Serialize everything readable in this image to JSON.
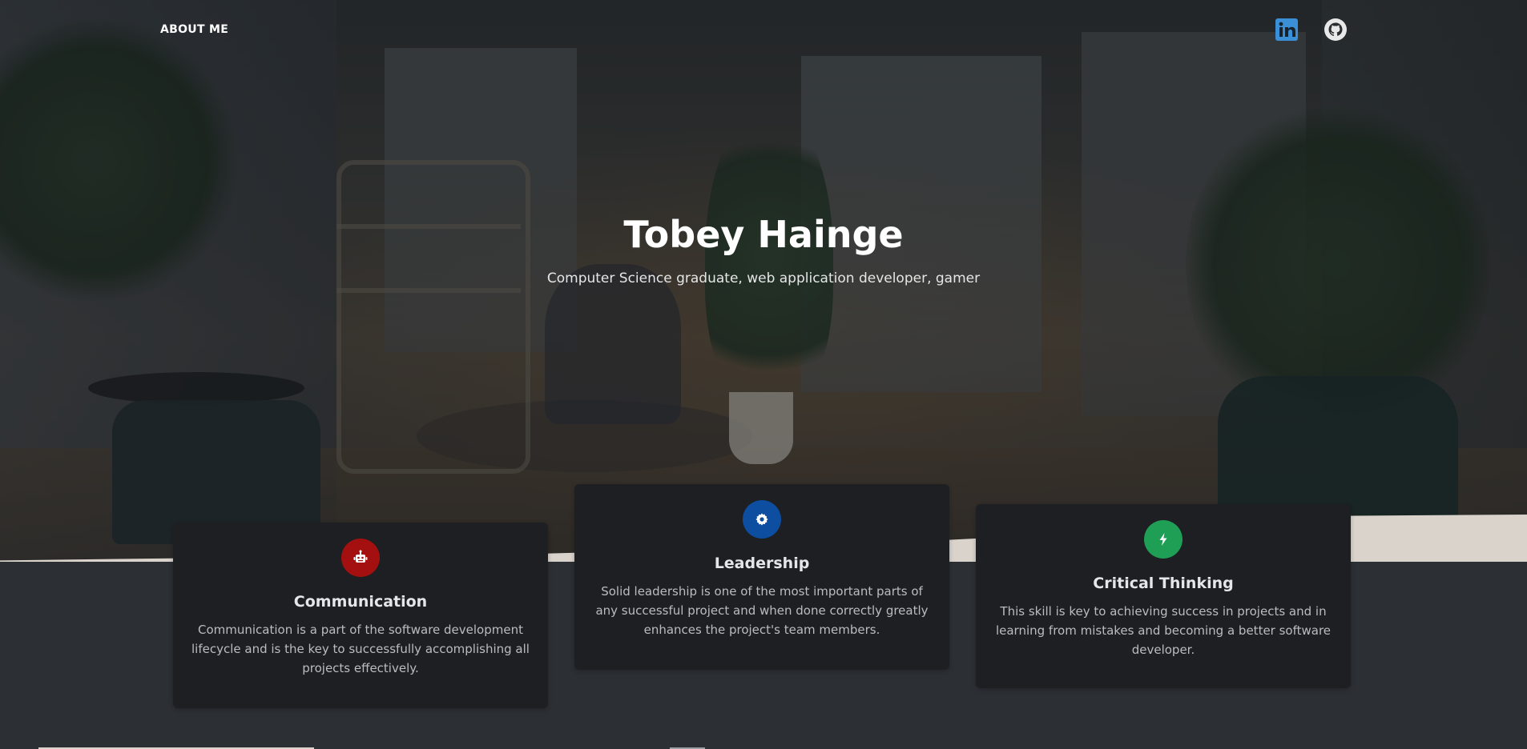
{
  "nav": {
    "about_label": "ABOUT ME",
    "social": [
      {
        "name": "linkedin",
        "icon": "linkedin-icon",
        "color": "#3b8fd6"
      },
      {
        "name": "github",
        "icon": "github-icon",
        "color": "#e8e8e8"
      }
    ]
  },
  "hero": {
    "title": "Tobey Hainge",
    "subtitle": "Computer Science graduate, web application developer, gamer"
  },
  "skills": [
    {
      "title": "Communication",
      "text": "Communication is a part of the software development lifecycle and is the key to successfully accomplishing all projects effectively.",
      "icon": "robot-icon",
      "color": "#a41010"
    },
    {
      "title": "Leadership",
      "text": "Solid leadership is one of the most important parts of any successful project and when done correctly greatly enhances the project's team members.",
      "icon": "cog-icon",
      "color": "#0d4ea0"
    },
    {
      "title": "Critical Thinking",
      "text": "This skill is key to achieving success in projects and in learning from mistakes and becoming a better software developer.",
      "icon": "lightning-icon",
      "color": "#1f9e55"
    }
  ]
}
